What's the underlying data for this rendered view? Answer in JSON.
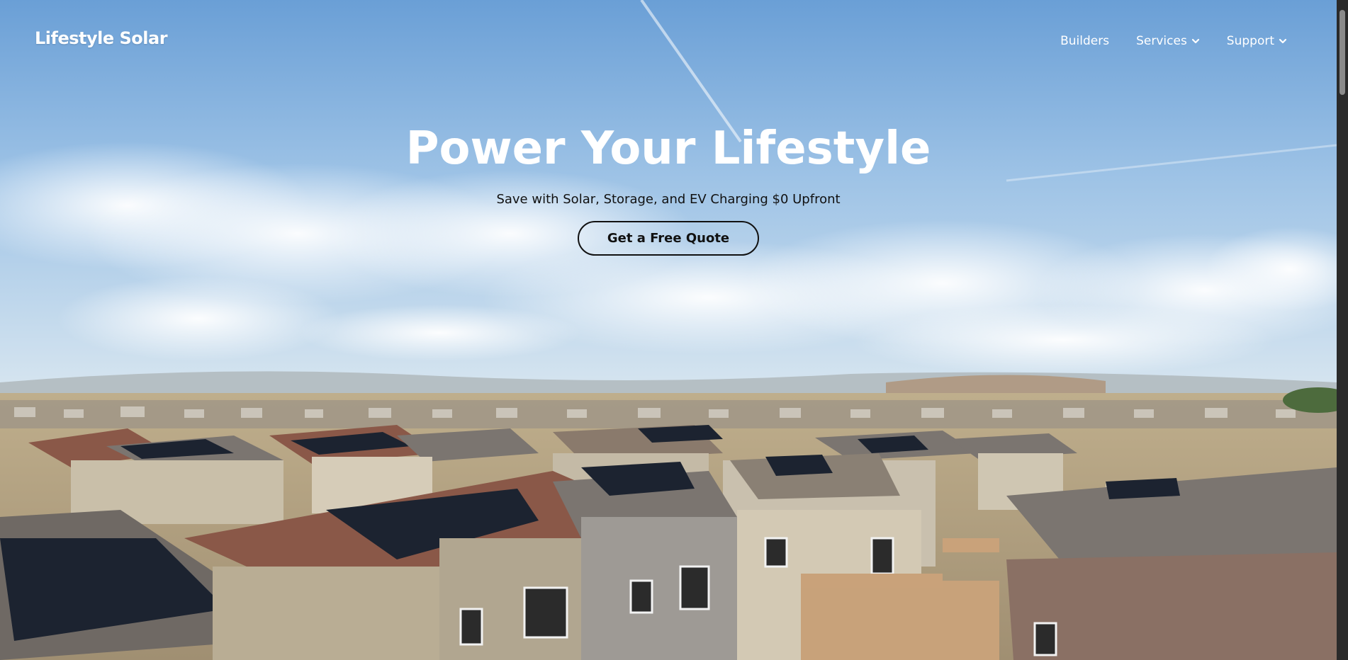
{
  "header": {
    "logo_text": "Lifestyle Solar",
    "nav": [
      {
        "label": "Builders",
        "has_dropdown": false
      },
      {
        "label": "Services",
        "has_dropdown": true
      },
      {
        "label": "Support",
        "has_dropdown": true
      }
    ]
  },
  "hero": {
    "title": "Power Your Lifestyle",
    "subtitle": "Save with Solar, Storage, and EV Charging $0 Upfront",
    "cta_label": "Get a Free Quote"
  },
  "colors": {
    "sky_top": "#6a9fd6",
    "sky_bottom": "#c9ddee",
    "roof_brown": "#8a5848",
    "roof_gray": "#7b7570",
    "wall_beige": "#c9bfa9",
    "panel_dark": "#1c2330",
    "text_dark": "#111111",
    "text_light": "#ffffff"
  }
}
